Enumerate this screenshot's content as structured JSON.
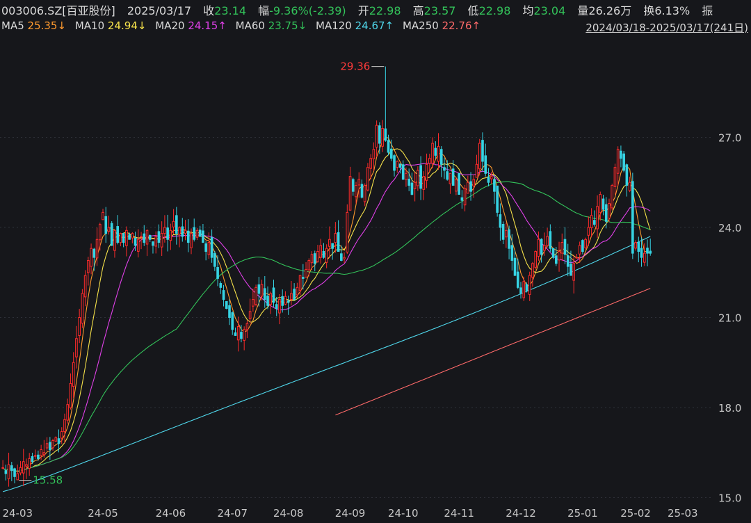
{
  "header": {
    "code": "003006.SZ[百亚股份]",
    "date": "2025/03/17",
    "close_label": "收",
    "close": "23.14",
    "chg_label": "幅",
    "chg": "-9.36%(-2.39)",
    "open_label": "开",
    "open": "22.98",
    "high_label": "高",
    "high": "23.57",
    "low_label": "低",
    "low": "22.98",
    "avg_label": "均",
    "avg": "23.04",
    "vol_label": "量",
    "vol": "26.26万",
    "turn_label": "换",
    "turn": "6.13%",
    "amp_label": "振"
  },
  "ma_legend": [
    {
      "label": "MA5",
      "value": "25.35",
      "arrow": "↓",
      "color": "#ff9a2e"
    },
    {
      "label": "MA10",
      "value": "24.94",
      "arrow": "↓",
      "color": "#f5e14a"
    },
    {
      "label": "MA20",
      "value": "24.15",
      "arrow": "↑",
      "color": "#e040e8"
    },
    {
      "label": "MA60",
      "value": "23.75",
      "arrow": "↓",
      "color": "#33c35a"
    },
    {
      "label": "MA120",
      "value": "24.67",
      "arrow": "↑",
      "color": "#4fd6ea"
    },
    {
      "label": "MA250",
      "value": "22.76",
      "arrow": "↑",
      "color": "#ff6a6a"
    }
  ],
  "range": "2024/03/18-2025/03/17(241日)",
  "colors": {
    "up": "#ff2b2b",
    "down": "#36d3e3",
    "bg": "#16171b",
    "grid": "#2e3038"
  },
  "chart_data": {
    "type": "candlestick",
    "y_ticks": [
      "15.0",
      "18.0",
      "21.0",
      "24.0",
      "27.0"
    ],
    "ylim": [
      14.85,
      30.3
    ],
    "x_ticks": [
      "24-03",
      "24-05",
      "24-06",
      "24-07",
      "24-08",
      "24-09",
      "24-10",
      "24-11",
      "24-12",
      "25-01",
      "25-02",
      "25-03"
    ],
    "x_tick_index": [
      5,
      34,
      57,
      78,
      97,
      118,
      136,
      155,
      176,
      197,
      215,
      231
    ],
    "n_bars": 241,
    "annotations": [
      {
        "text": "29.36",
        "bar": 130,
        "value": 29.36,
        "kind": "max"
      },
      {
        "text": "15.58",
        "bar": 5,
        "value": 15.58,
        "kind": "min"
      }
    ],
    "close_series": [
      16.0,
      15.8,
      16.1,
      15.9,
      15.7,
      15.8,
      16.0,
      16.2,
      16.1,
      16.3,
      16.2,
      16.4,
      16.3,
      16.6,
      16.5,
      16.8,
      16.6,
      16.9,
      17.0,
      16.8,
      17.2,
      17.6,
      18.1,
      18.8,
      19.5,
      20.3,
      21.0,
      21.8,
      22.4,
      22.9,
      23.3,
      23.0,
      23.6,
      24.1,
      24.5,
      23.8,
      24.0,
      23.4,
      23.9,
      23.5,
      23.8,
      23.5,
      23.9,
      23.6,
      23.8,
      23.4,
      23.6,
      23.7,
      23.5,
      23.9,
      23.6,
      23.4,
      23.7,
      23.5,
      23.8,
      24.0,
      23.6,
      23.9,
      24.2,
      23.8,
      24.0,
      23.7,
      23.9,
      23.5,
      23.8,
      23.6,
      23.9,
      23.7,
      23.5,
      23.2,
      23.5,
      23.0,
      22.7,
      22.3,
      22.0,
      21.6,
      21.3,
      21.0,
      20.6,
      20.4,
      20.7,
      20.3,
      20.6,
      20.8,
      21.2,
      21.6,
      22.0,
      21.8,
      22.1,
      21.6,
      21.4,
      21.8,
      21.5,
      21.3,
      21.6,
      21.4,
      21.7,
      21.5,
      21.8,
      21.6,
      22.0,
      22.4,
      22.3,
      22.6,
      22.9,
      23.1,
      22.8,
      23.2,
      23.4,
      23.0,
      23.3,
      23.6,
      23.3,
      23.8,
      23.2,
      22.9,
      23.0,
      24.5,
      25.7,
      25.2,
      25.4,
      25.6,
      25.0,
      25.4,
      26.0,
      26.3,
      26.6,
      27.4,
      26.8,
      27.3,
      26.9,
      26.5,
      26.3,
      25.9,
      26.2,
      26.0,
      25.6,
      25.8,
      25.4,
      25.1,
      25.5,
      25.9,
      25.3,
      25.7,
      26.1,
      26.3,
      26.8,
      26.4,
      26.7,
      26.1,
      25.9,
      25.6,
      25.8,
      25.4,
      25.6,
      25.1,
      24.9,
      25.3,
      25.5,
      25.2,
      25.6,
      26.1,
      26.8,
      26.2,
      25.8,
      25.5,
      25.7,
      25.2,
      24.5,
      24.0,
      23.6,
      23.9,
      23.3,
      22.9,
      22.4,
      22.0,
      21.8,
      22.2,
      21.9,
      22.4,
      22.8,
      23.2,
      23.6,
      23.1,
      23.4,
      23.7,
      23.3,
      23.0,
      22.8,
      23.2,
      23.5,
      23.1,
      22.7,
      22.4,
      22.8,
      23.0,
      23.4,
      23.2,
      23.6,
      24.0,
      24.4,
      24.1,
      24.7,
      25.1,
      24.6,
      24.2,
      24.8,
      25.4,
      26.0,
      26.6,
      26.3,
      25.9,
      25.4,
      25.5,
      23.14,
      23.5,
      23.2,
      23.0,
      23.14,
      23.14,
      23.14
    ]
  }
}
